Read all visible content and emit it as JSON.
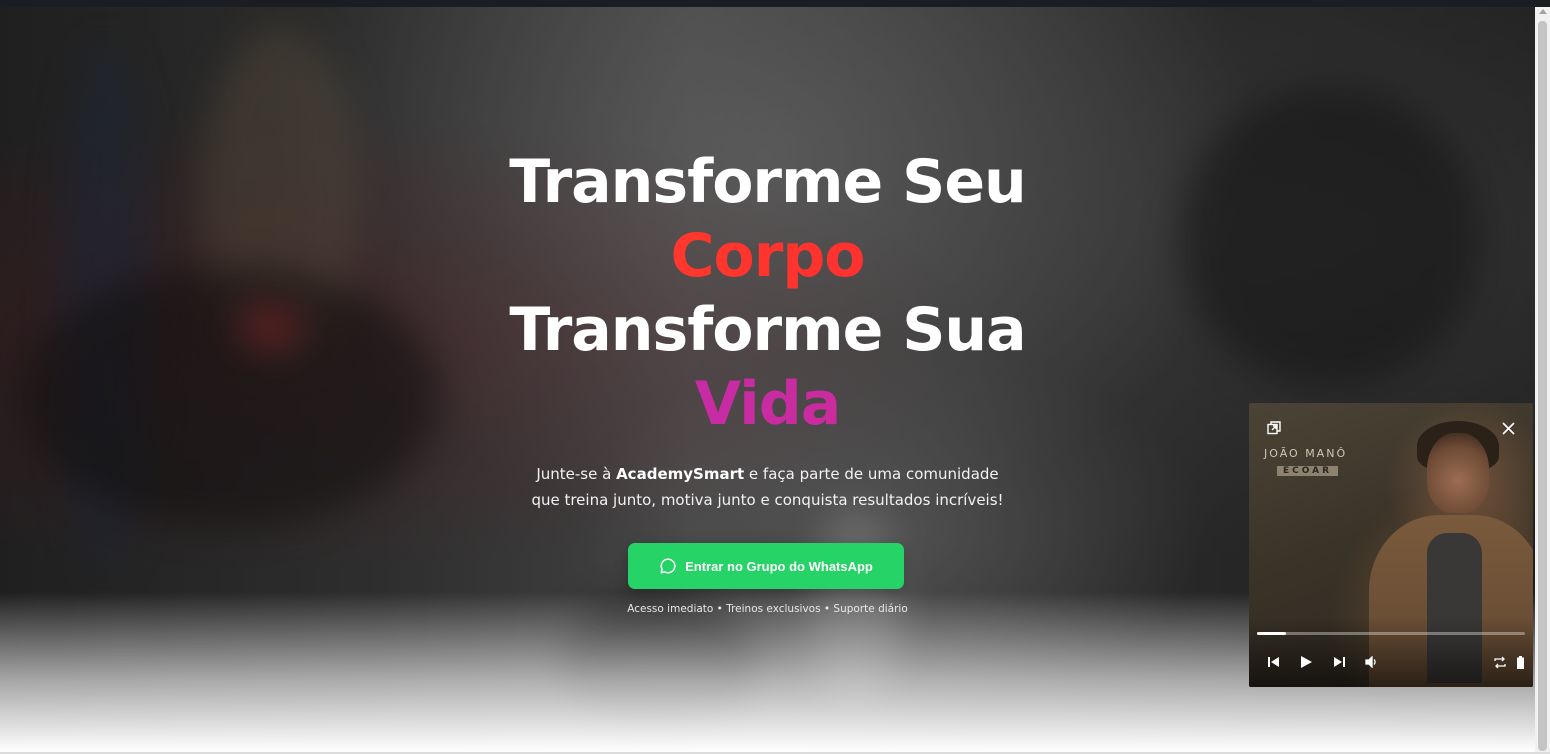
{
  "hero": {
    "headline_line1": "Transforme Seu",
    "headline_word1": "Corpo",
    "headline_line2": "Transforme Sua",
    "headline_word2": "Vida",
    "subtitle_prefix": "Junte-se à ",
    "subtitle_brand": "AcademySmart",
    "subtitle_suffix": " e faça parte de uma comunidade que treina junto, motiva junto e conquista resultados incríveis!",
    "cta_label": "Entrar no Grupo do WhatsApp",
    "cta_icon": "whatsapp-icon",
    "microcopy": "Acesso imediato • Treinos exclusivos • Suporte diário"
  },
  "colors": {
    "cta_bg": "#25d366",
    "accent_corpo": "#ff2a2a",
    "accent_vida": "#c42ab0"
  },
  "player": {
    "artist": "JOÃO MANÔ",
    "album": "ECOAR",
    "progress": 0.11,
    "icons": [
      "pip-icon",
      "close-icon",
      "previous-icon",
      "play-icon",
      "next-icon",
      "volume-icon",
      "loop-icon",
      "battery-icon"
    ]
  }
}
